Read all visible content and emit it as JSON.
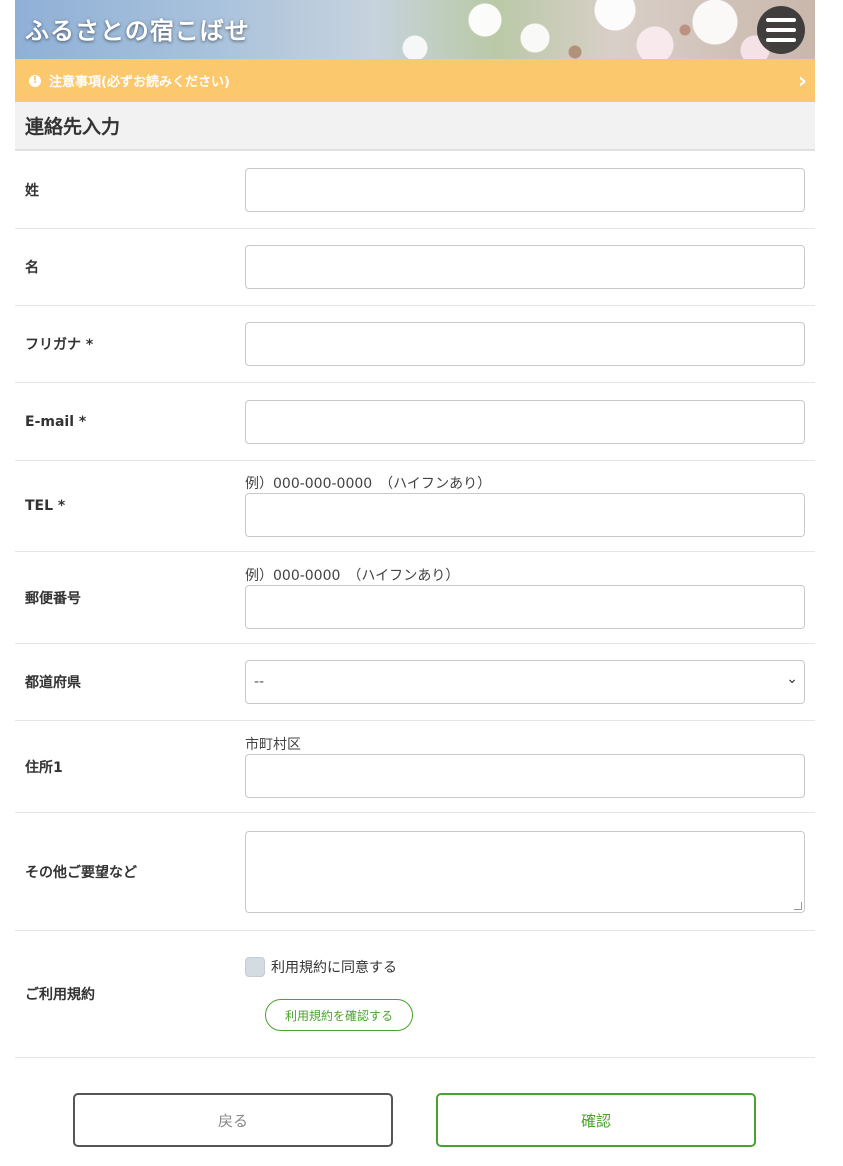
{
  "header": {
    "brand": "ふるさとの宿こばせ",
    "menu_icon": "hamburger-menu-icon"
  },
  "notice": {
    "icon": "exclamation-circle-icon",
    "text": "注意事項(必ずお読みください)",
    "chevron": "›"
  },
  "section": {
    "title": "連絡先入力"
  },
  "form": {
    "last_name": {
      "label": "姓",
      "value": ""
    },
    "first_name": {
      "label": "名",
      "value": ""
    },
    "furigana": {
      "label": "フリガナ *",
      "value": ""
    },
    "email": {
      "label": "E-mail *",
      "value": ""
    },
    "tel": {
      "label": "TEL *",
      "hint": "例）000-000-0000　（ハイフンあり）",
      "value": ""
    },
    "postal": {
      "label": "郵便番号",
      "hint": "例）000-0000　（ハイフンあり）",
      "value": ""
    },
    "prefecture": {
      "label": "都道府県",
      "selected": "--",
      "chevron": "⌄"
    },
    "address1": {
      "label": "住所1",
      "hint": "市町村区",
      "value": ""
    },
    "requests": {
      "label": "その他ご要望など",
      "value": ""
    },
    "terms": {
      "label": "ご利用規約",
      "agree_text": "利用規約に同意する",
      "agree_checked": false,
      "view_button": "利用規約を確認する"
    }
  },
  "actions": {
    "back": "戻る",
    "confirm": "確認"
  },
  "colors": {
    "notice_bg": "#fcc86d",
    "accent_green": "#4aa32e"
  }
}
